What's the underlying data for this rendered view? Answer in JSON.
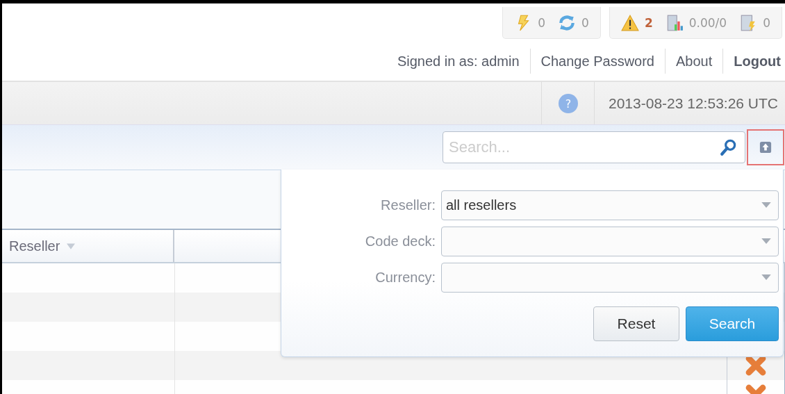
{
  "status_groups": [
    {
      "items": [
        {
          "kind": "lightning",
          "count": "0",
          "highlighted": false
        },
        {
          "kind": "sync",
          "count": "0",
          "highlighted": false
        }
      ]
    },
    {
      "items": [
        {
          "kind": "warning",
          "count": "2",
          "highlighted": true
        },
        {
          "kind": "chart",
          "count": "0.00/0",
          "highlighted": false
        },
        {
          "kind": "document",
          "count": "0",
          "highlighted": false
        }
      ]
    }
  ],
  "user_links": [
    {
      "text": "Signed in as: admin",
      "kind": "text"
    },
    {
      "text": "Change Password",
      "kind": "link"
    },
    {
      "text": "About",
      "kind": "link"
    },
    {
      "text": "Logout",
      "kind": "strong"
    }
  ],
  "help": {
    "icon": "?"
  },
  "datetime": "2013-08-23 12:53:26 UTC",
  "search": {
    "placeholder": "Search..."
  },
  "table": {
    "columns": [
      {
        "label": "Reseller",
        "sortable": true
      }
    ],
    "rows": [
      {
        "kind": "plain"
      },
      {
        "kind": "plain"
      },
      {
        "kind": "plain"
      },
      {
        "kind": "deletable"
      },
      {
        "kind": "deletable"
      }
    ]
  },
  "filter": {
    "fields": [
      {
        "label": "Reseller:",
        "value": "all resellers"
      },
      {
        "label": "Code deck:"
      },
      {
        "label": "Currency:"
      }
    ],
    "buttons": [
      {
        "label": "Reset",
        "kind": "default"
      },
      {
        "label": "Search",
        "kind": "primary"
      }
    ]
  }
}
